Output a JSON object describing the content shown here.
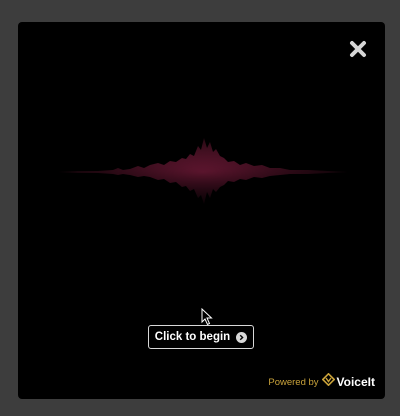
{
  "modal": {
    "begin_button_label": "Click to begin",
    "powered_by_label": "Powered by",
    "brand_name": "VoiceIt"
  },
  "colors": {
    "backdrop": "#3d3d3d",
    "modal_bg": "#000000",
    "waveform": "#a0264f",
    "brand_accent": "#c9a23a"
  },
  "icons": {
    "close": "close-icon",
    "chevron": "chevron-right-icon",
    "brand": "voiceit-logo-icon",
    "cursor": "mouse-pointer-icon"
  }
}
